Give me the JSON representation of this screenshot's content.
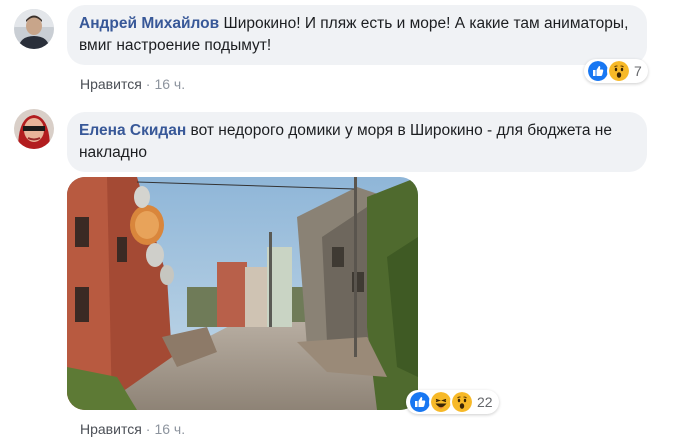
{
  "comments": [
    {
      "author": "Андрей Михайлов",
      "text": "Широкино! И пляж есть и море! А какие там аниматоры, вмиг настроение подымут!",
      "like_label": "Нравится",
      "time": "16 ч.",
      "reaction_icons": [
        "like-icon",
        "wow-icon"
      ],
      "reaction_count": "7"
    },
    {
      "author": "Елена Скидан",
      "text": "вот недорого домики у моря в Широкино - для бюджета не накладно",
      "like_label": "Нравится",
      "time": "16 ч.",
      "reaction_icons": [
        "like-icon",
        "haha-icon",
        "wow-icon"
      ],
      "reaction_count": "22"
    }
  ],
  "colors": {
    "author": "#385898",
    "bubble": "#f0f2f5",
    "like_blue": "#1877f2",
    "emoji_yellow": "#f7b928"
  }
}
